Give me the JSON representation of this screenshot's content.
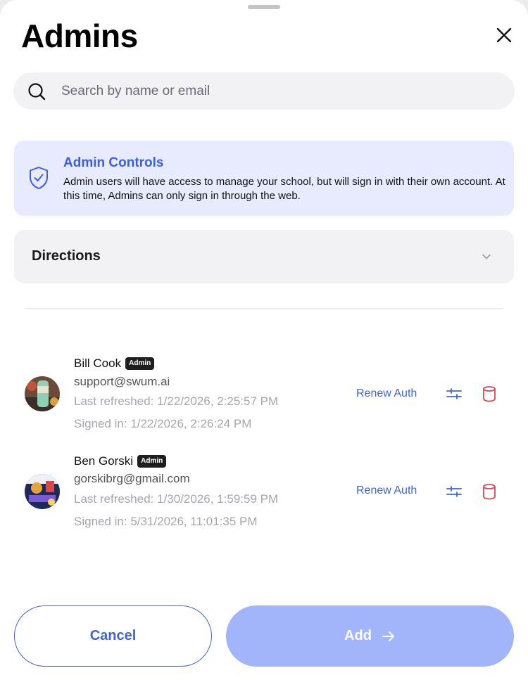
{
  "header": {
    "title": "Admins"
  },
  "search": {
    "placeholder": "Search by name or email",
    "value": ""
  },
  "notice": {
    "title": "Admin Controls",
    "body": "Admin users will have access to manage your school, but will sign in with their own account. At this time, Admins can only sign in through the web."
  },
  "directions": {
    "label": "Directions"
  },
  "admins": [
    {
      "name": "Bill Cook",
      "badge": "Admin",
      "email": "support@swum.ai",
      "last_refreshed": "Last refreshed: 1/22/2026, 2:25:57 PM",
      "signed_in": "Signed in: 1/22/2026, 2:26:24 PM",
      "renew_label": "Renew Auth"
    },
    {
      "name": "Ben Gorski",
      "badge": "Admin",
      "email": "gorskibrg@gmail.com",
      "last_refreshed": "Last refreshed: 1/30/2026, 1:59:59 PM",
      "signed_in": "Signed in: 5/31/2026, 11:01:35 PM",
      "renew_label": "Renew Auth"
    }
  ],
  "footer": {
    "cancel_label": "Cancel",
    "add_label": "Add"
  },
  "colors": {
    "accent": "#3f63dc",
    "notice_bg": "#e7ebfd",
    "add_disabled": "#a3b5fa",
    "delete": "#e0455a"
  }
}
